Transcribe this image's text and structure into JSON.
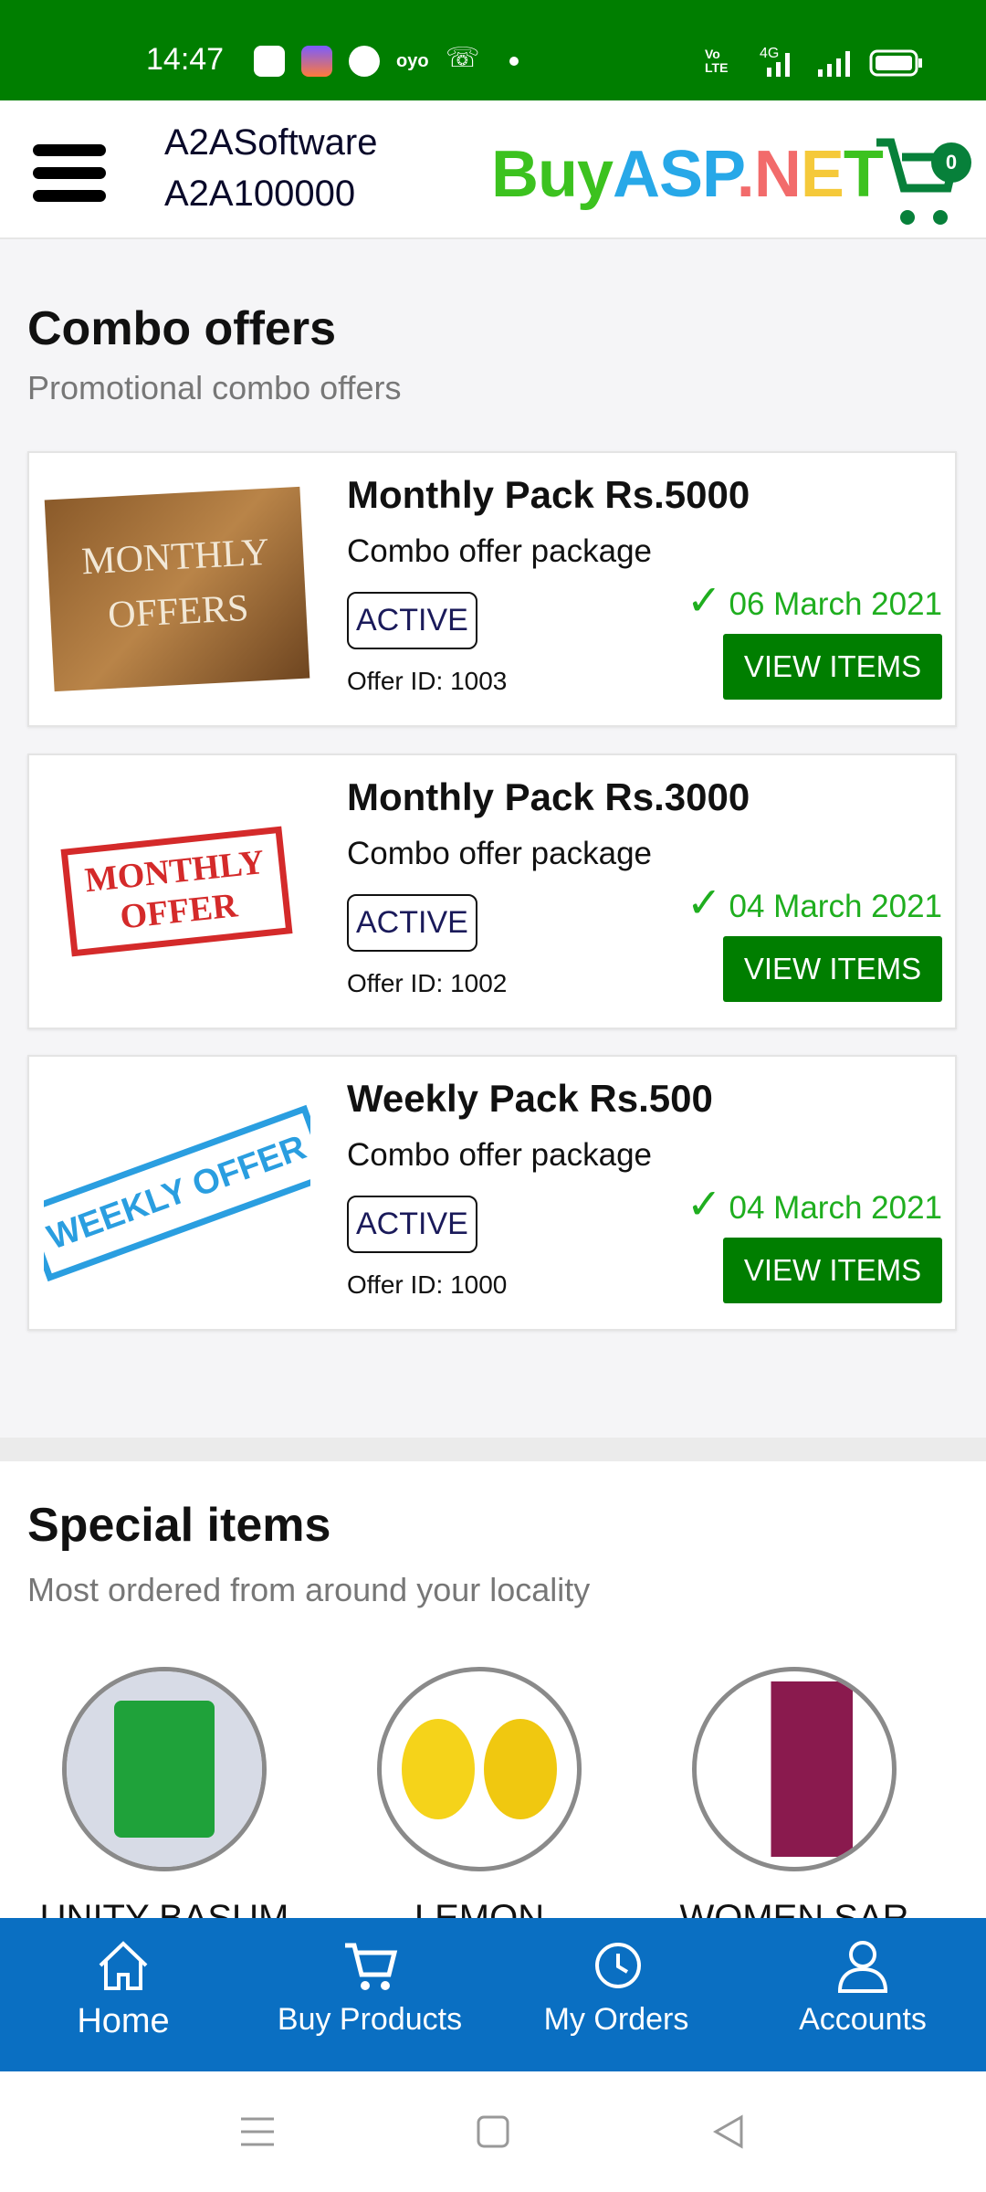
{
  "status_bar": {
    "time": "14:47",
    "network": "4G"
  },
  "header": {
    "account_name": "A2ASoftware",
    "account_id": "A2A100000",
    "logo": [
      "Buy",
      "ASP",
      ".",
      "N",
      "E",
      "T"
    ],
    "cart_count": "0"
  },
  "combo": {
    "title": "Combo offers",
    "subtitle": "Promotional combo offers",
    "offers": [
      {
        "name": "Monthly Pack Rs.5000",
        "desc": "Combo offer package",
        "status": "ACTIVE",
        "offer_id": "Offer ID: 1003",
        "date": "06 March 2021",
        "button": "VIEW ITEMS",
        "image_text": [
          "MONTHLY",
          "OFFERS"
        ]
      },
      {
        "name": "Monthly Pack Rs.3000",
        "desc": "Combo offer package",
        "status": "ACTIVE",
        "offer_id": "Offer ID: 1002",
        "date": "04 March 2021",
        "button": "VIEW ITEMS",
        "image_text": [
          "MONTHLY",
          "OFFER"
        ]
      },
      {
        "name": "Weekly Pack Rs.500",
        "desc": "Combo offer package",
        "status": "ACTIVE",
        "offer_id": "Offer ID: 1000",
        "date": "04 March 2021",
        "button": "VIEW ITEMS",
        "image_text": [
          "WEEKLY OFFER"
        ]
      }
    ]
  },
  "special": {
    "title": "Special items",
    "subtitle": "Most ordered from around your locality",
    "items": [
      {
        "label": "UNITY BASUM"
      },
      {
        "label": "LEMON"
      },
      {
        "label": "WOMEN SAR"
      }
    ]
  },
  "bottom_nav": [
    {
      "label": "Home",
      "icon": "home-icon"
    },
    {
      "label": "Buy Products",
      "icon": "cart-icon"
    },
    {
      "label": "My Orders",
      "icon": "history-icon"
    },
    {
      "label": "Accounts",
      "icon": "user-icon"
    }
  ],
  "colors": {
    "primary": "#007e00",
    "nav": "#0a6fc2",
    "date": "#1fae1f"
  }
}
